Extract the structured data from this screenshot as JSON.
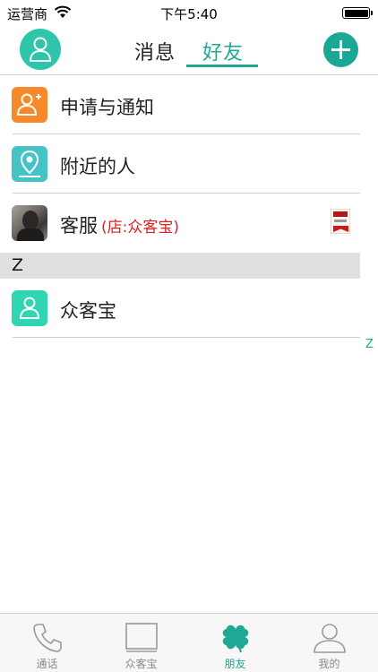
{
  "status_bar": {
    "carrier": "运营商",
    "time": "下午5:40"
  },
  "header": {
    "tabs": [
      "消息",
      "好友"
    ],
    "active_tab": "好友"
  },
  "list": {
    "items": [
      {
        "label": "申请与通知",
        "icon": "person-add-icon"
      },
      {
        "label": "附近的人",
        "icon": "location-pin-icon"
      },
      {
        "label": "客服",
        "shop": "(店:众客宝)",
        "icon": "avatar-photo"
      }
    ],
    "sections": [
      {
        "letter": "Z",
        "contacts": [
          {
            "label": "众客宝",
            "icon": "person-icon"
          }
        ]
      }
    ],
    "index_letters": [
      "Z"
    ]
  },
  "tabbar": {
    "items": [
      {
        "label": "通话",
        "icon": "phone-icon"
      },
      {
        "label": "众客宝",
        "icon": "store-icon"
      },
      {
        "label": "朋友",
        "icon": "clover-icon"
      },
      {
        "label": "我的",
        "icon": "profile-icon"
      }
    ],
    "active": "朋友"
  },
  "colors": {
    "accent": "#1fa895",
    "orange": "#f68a2a",
    "teal_icon": "#46c3c7",
    "green_icon": "#2ed6b1",
    "shop_red": "#e02020"
  }
}
